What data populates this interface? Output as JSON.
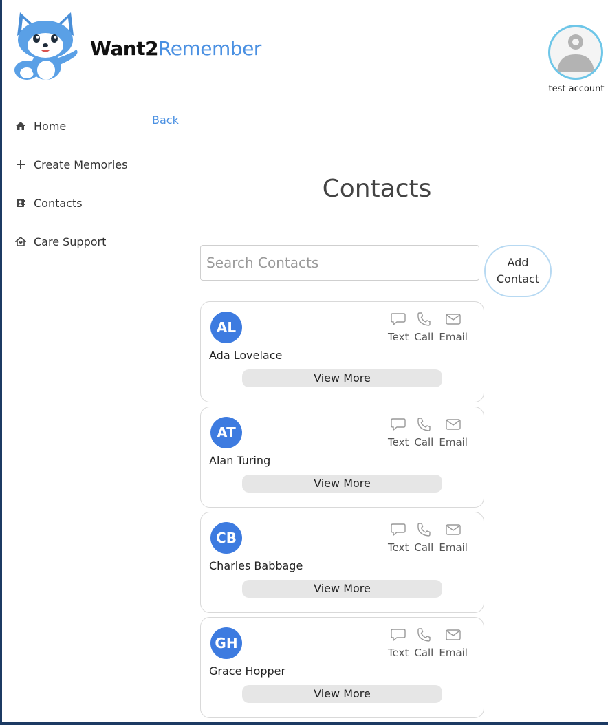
{
  "brand": {
    "part1": "Want2",
    "part2": "Remember"
  },
  "account": {
    "name": "test account"
  },
  "nav": [
    {
      "label": "Home",
      "icon": "home-icon"
    },
    {
      "label": "Create Memories",
      "icon": "plus-icon"
    },
    {
      "label": "Contacts",
      "icon": "address-book-icon"
    },
    {
      "label": "Care Support",
      "icon": "house-heart-icon"
    }
  ],
  "back_label": "Back",
  "page_title": "Contacts",
  "search": {
    "placeholder": "Search Contacts",
    "value": ""
  },
  "add_contact": {
    "line1": "Add",
    "line2": "Contact"
  },
  "actions": {
    "text": "Text",
    "call": "Call",
    "email": "Email"
  },
  "view_more_label": "View More",
  "contacts": [
    {
      "initials": "AL",
      "name": "Ada Lovelace"
    },
    {
      "initials": "AT",
      "name": "Alan Turing"
    },
    {
      "initials": "CB",
      "name": "Charles Babbage"
    },
    {
      "initials": "GH",
      "name": "Grace Hopper"
    }
  ],
  "colors": {
    "accent": "#4a90e2",
    "initials_bg": "#3d7be0",
    "frame": "#1c3a63",
    "avatar_ring": "#6ec6e8"
  }
}
